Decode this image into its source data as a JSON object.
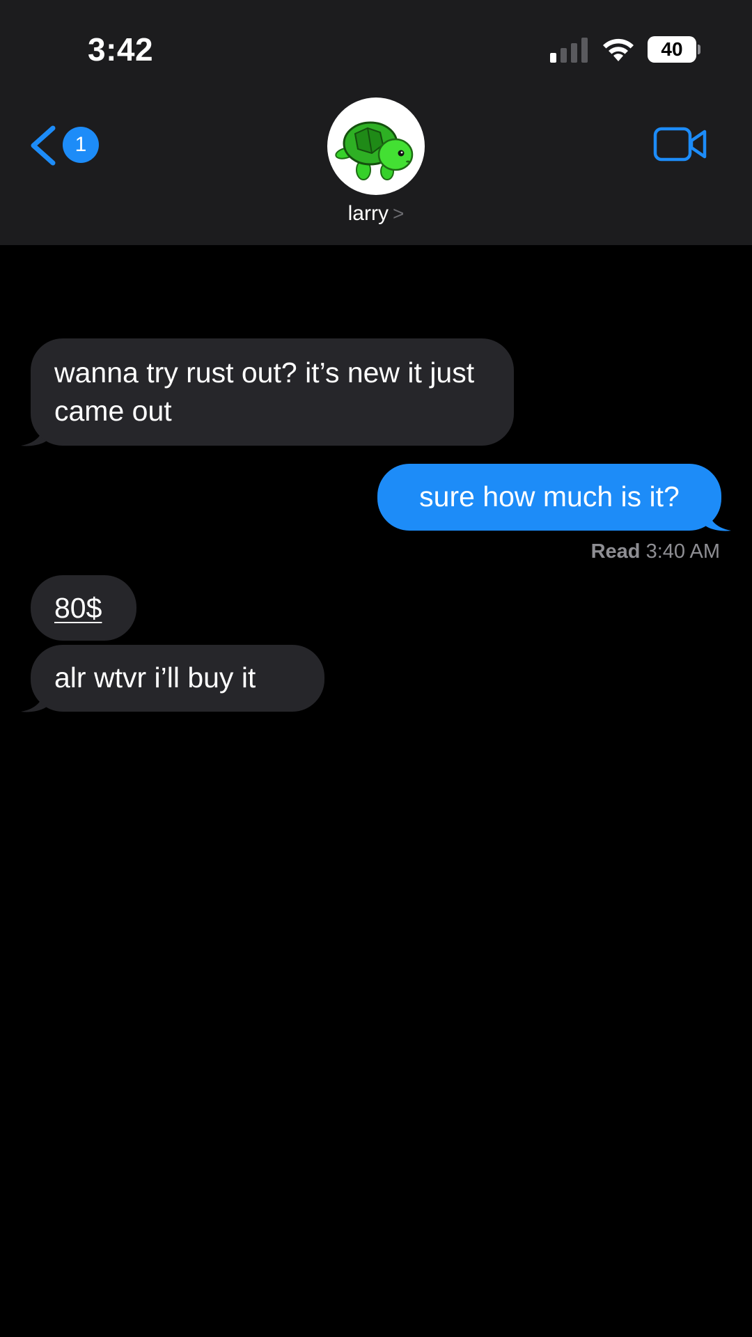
{
  "status_bar": {
    "time": "3:42",
    "battery_level": "40",
    "signal_bars_filled": 1,
    "signal_bars_total": 4
  },
  "nav": {
    "back_badge": "1",
    "contact_name": "larry",
    "contact_chevron": ">",
    "avatar": "turtle-avatar"
  },
  "messages": [
    {
      "direction": "received",
      "text": "wanna try rust out? it’s new it just came out"
    },
    {
      "direction": "sent",
      "text": "sure how much is it?"
    },
    {
      "direction": "received",
      "text": "80$"
    },
    {
      "direction": "received",
      "text": "alr wtvr i’ll buy it"
    }
  ],
  "read_receipt": {
    "label": "Read",
    "time": "3:40 AM"
  },
  "colors": {
    "background": "#000000",
    "header": "#1c1c1e",
    "received_bubble": "#26262a",
    "sent_bubble": "#1d8cf8",
    "accent": "#1d8cf8",
    "secondary_text": "#8e8e93"
  }
}
